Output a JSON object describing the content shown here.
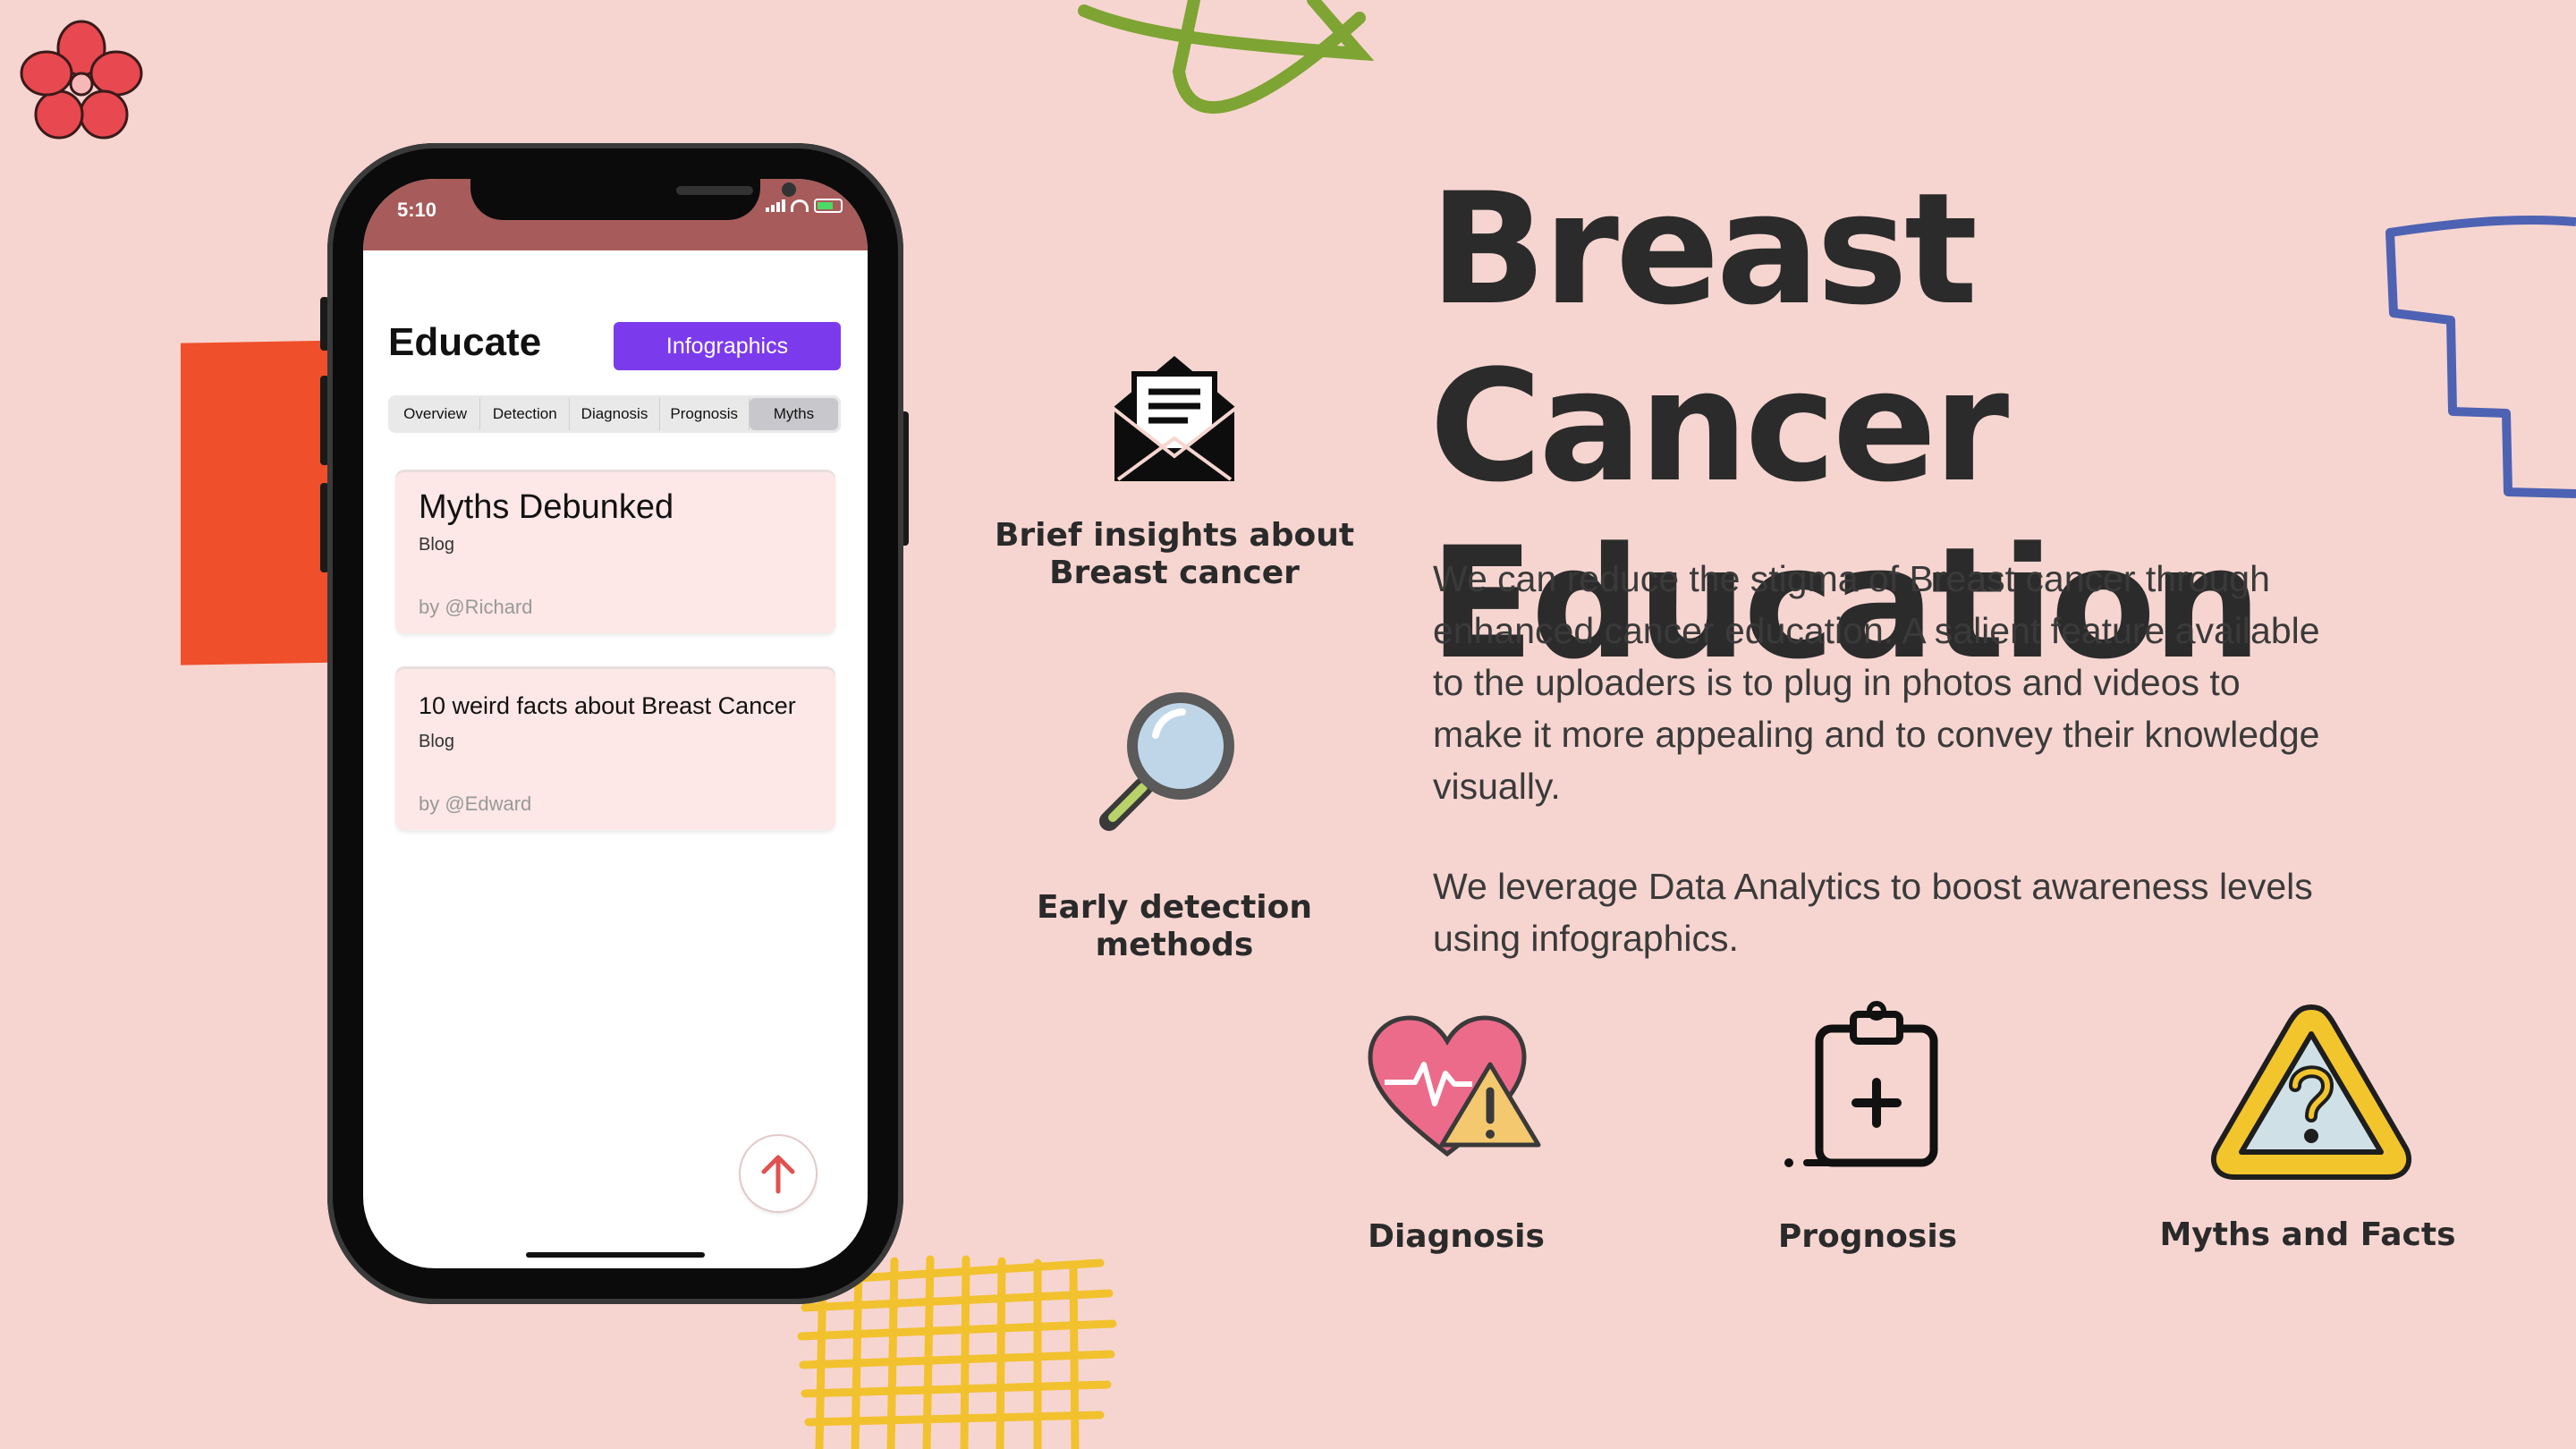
{
  "phone": {
    "status_time": "5:10",
    "app_title": "Educate",
    "infographics_label": "Infographics",
    "tabs": [
      {
        "label": "Overview",
        "active": false
      },
      {
        "label": "Detection",
        "active": false
      },
      {
        "label": "Diagnosis",
        "active": false
      },
      {
        "label": "Prognosis",
        "active": false
      },
      {
        "label": "Myths",
        "active": true
      }
    ],
    "cards": [
      {
        "title": "Myths Debunked",
        "type": "Blog",
        "author": "by @Richard"
      },
      {
        "title": "10 weird facts about Breast Cancer",
        "type": "Blog",
        "author": "by @Edward"
      }
    ],
    "fab_icon": "arrow-up-icon"
  },
  "headline": {
    "line1": "Breast Cancer",
    "line2": "Education"
  },
  "description": {
    "p1": "We can reduce the stigma of Breast cancer through enhanced cancer education. A salient feature available to the uploaders is to plug in photos and videos to make it more appealing and to convey their knowledge visually.",
    "p2": "We leverage Data Analytics to boost awareness levels using infographics."
  },
  "features": {
    "insights": {
      "label_line1": "Brief insights about",
      "label_line2": "Breast cancer",
      "icon": "envelope-icon"
    },
    "detection": {
      "label": "Early detection methods",
      "icon": "magnifier-icon"
    },
    "diagnosis": {
      "label": "Diagnosis",
      "icon": "heart-warning-icon"
    },
    "prognosis": {
      "label": "Prognosis",
      "icon": "clipboard-plus-icon"
    },
    "myths": {
      "label": "Myths and Facts",
      "icon": "question-triangle-icon"
    }
  },
  "colors": {
    "background": "#f6d5d0",
    "accent_purple": "#7c3aed",
    "status_bar": "#a75b5a",
    "card_bg": "#fde7e7",
    "heading": "#2b2b2b"
  }
}
